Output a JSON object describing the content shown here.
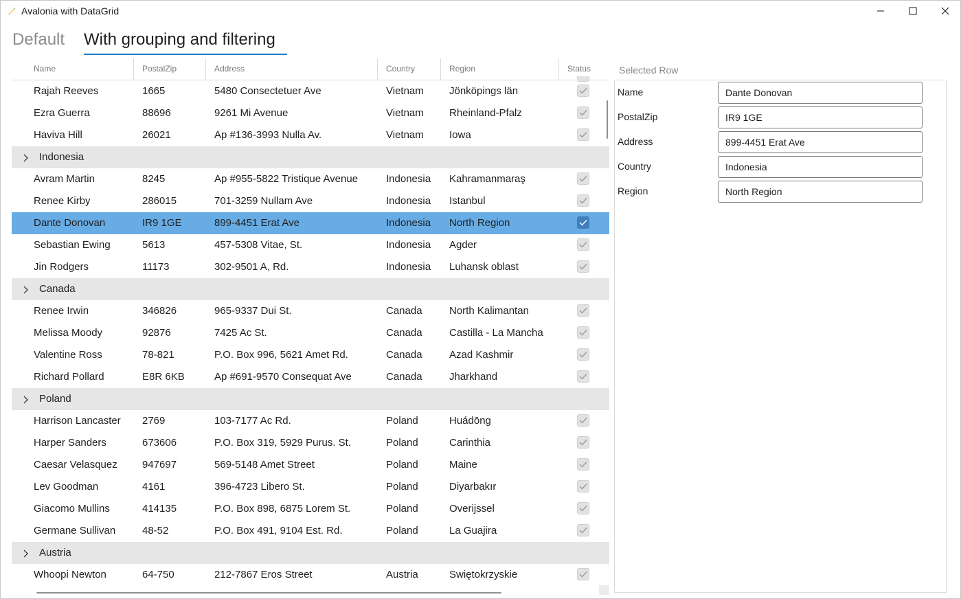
{
  "window": {
    "title": "Avalonia with DataGrid"
  },
  "tabs": [
    {
      "label": "Default",
      "active": false
    },
    {
      "label": "With grouping and filtering",
      "active": true
    }
  ],
  "grid": {
    "columns": [
      "Name",
      "PostalZip",
      "Address",
      "Country",
      "Region",
      "Status"
    ],
    "rows": [
      {
        "kind": "data",
        "name": "Rajah Reeves",
        "postal": "1665",
        "address": "5480 Consectetuer Ave",
        "country": "Vietnam",
        "region": "Jönköpings län",
        "checked": true
      },
      {
        "kind": "data",
        "name": "Ezra Guerra",
        "postal": "88696",
        "address": "9261 Mi Avenue",
        "country": "Vietnam",
        "region": "Rheinland-Pfalz",
        "checked": true
      },
      {
        "kind": "data",
        "name": "Haviva Hill",
        "postal": "26021",
        "address": "Ap #136-3993 Nulla Av.",
        "country": "Vietnam",
        "region": "Iowa",
        "checked": true
      },
      {
        "kind": "group",
        "label": "Indonesia"
      },
      {
        "kind": "data",
        "name": "Avram Martin",
        "postal": "8245",
        "address": "Ap #955-5822 Tristique Avenue",
        "country": "Indonesia",
        "region": "Kahramanmaraş",
        "checked": true
      },
      {
        "kind": "data",
        "name": "Renee Kirby",
        "postal": "286015",
        "address": "701-3259 Nullam Ave",
        "country": "Indonesia",
        "region": "Istanbul",
        "checked": true
      },
      {
        "kind": "data",
        "name": "Dante Donovan",
        "postal": "IR9 1GE",
        "address": "899-4451 Erat Ave",
        "country": "Indonesia",
        "region": "North Region",
        "checked": true,
        "selected": true
      },
      {
        "kind": "data",
        "name": "Sebastian Ewing",
        "postal": "5613",
        "address": "457-5308 Vitae, St.",
        "country": "Indonesia",
        "region": "Agder",
        "checked": true
      },
      {
        "kind": "data",
        "name": "Jin Rodgers",
        "postal": "11173",
        "address": "302-9501 A, Rd.",
        "country": "Indonesia",
        "region": "Luhansk oblast",
        "checked": true
      },
      {
        "kind": "group",
        "label": "Canada"
      },
      {
        "kind": "data",
        "name": "Renee Irwin",
        "postal": "346826",
        "address": "965-9337 Dui St.",
        "country": "Canada",
        "region": "North Kalimantan",
        "checked": true
      },
      {
        "kind": "data",
        "name": "Melissa Moody",
        "postal": "92876",
        "address": "7425 Ac St.",
        "country": "Canada",
        "region": "Castilla - La Mancha",
        "checked": true
      },
      {
        "kind": "data",
        "name": "Valentine Ross",
        "postal": "78-821",
        "address": "P.O. Box 996, 5621 Amet Rd.",
        "country": "Canada",
        "region": "Azad Kashmir",
        "checked": true
      },
      {
        "kind": "data",
        "name": "Richard Pollard",
        "postal": "E8R 6KB",
        "address": "Ap #691-9570 Consequat Ave",
        "country": "Canada",
        "region": "Jharkhand",
        "checked": true
      },
      {
        "kind": "group",
        "label": "Poland"
      },
      {
        "kind": "data",
        "name": "Harrison Lancaster",
        "postal": "2769",
        "address": "103-7177 Ac Rd.",
        "country": "Poland",
        "region": "Huádōng",
        "checked": true
      },
      {
        "kind": "data",
        "name": "Harper Sanders",
        "postal": "673606",
        "address": "P.O. Box 319, 5929 Purus. St.",
        "country": "Poland",
        "region": "Carinthia",
        "checked": true
      },
      {
        "kind": "data",
        "name": "Caesar Velasquez",
        "postal": "947697",
        "address": "569-5148 Amet Street",
        "country": "Poland",
        "region": "Maine",
        "checked": true
      },
      {
        "kind": "data",
        "name": "Lev Goodman",
        "postal": "4161",
        "address": "396-4723 Libero St.",
        "country": "Poland",
        "region": "Diyarbakır",
        "checked": true
      },
      {
        "kind": "data",
        "name": "Giacomo Mullins",
        "postal": "414135",
        "address": "P.O. Box 898, 6875 Lorem St.",
        "country": "Poland",
        "region": "Overijssel",
        "checked": true
      },
      {
        "kind": "data",
        "name": "Germane Sullivan",
        "postal": "48-52",
        "address": "P.O. Box 491, 9104 Est. Rd.",
        "country": "Poland",
        "region": "La Guajira",
        "checked": true
      },
      {
        "kind": "group",
        "label": "Austria"
      },
      {
        "kind": "data",
        "name": "Whoopi Newton",
        "postal": "64-750",
        "address": "212-7867 Eros Street",
        "country": "Austria",
        "region": "Swiętokrzyskie",
        "checked": true
      }
    ]
  },
  "selected_panel": {
    "title": "Selected Row",
    "fields": [
      {
        "label": "Name",
        "value": "Dante Donovan"
      },
      {
        "label": "PostalZip",
        "value": "IR9 1GE"
      },
      {
        "label": "Address",
        "value": "899-4451 Erat Ave"
      },
      {
        "label": "Country",
        "value": "Indonesia"
      },
      {
        "label": "Region",
        "value": "North Region"
      }
    ]
  },
  "colors": {
    "accent": "#1f7fc8",
    "selected_row": "#67ace5",
    "group_row": "#e6e6e6"
  }
}
